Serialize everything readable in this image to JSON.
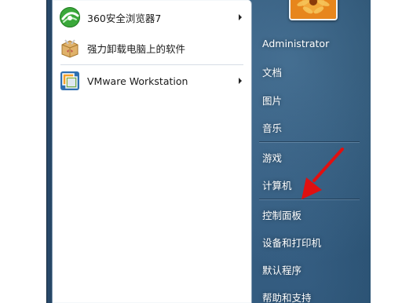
{
  "start_menu": {
    "programs": [
      {
        "label": "360安全浏览器7",
        "icon": "browser-360-icon",
        "has_submenu": true
      },
      {
        "label": "强力卸载电脑上的软件",
        "icon": "uninstall-box-icon",
        "has_submenu": false
      },
      {
        "label": "VMware Workstation",
        "icon": "vmware-icon",
        "has_submenu": true
      }
    ],
    "right_items": {
      "user": "Administrator",
      "documents": "文档",
      "pictures": "图片",
      "music": "音乐",
      "games": "游戏",
      "computer": "计算机",
      "control_panel": "控制面板",
      "devices_printers": "设备和打印机",
      "default_programs": "默认程序",
      "help_support": "帮助和支持"
    },
    "user_picture": "flower-avatar",
    "annotation": {
      "type": "red-arrow",
      "target": "控制面板",
      "color": "#e01010"
    }
  },
  "colors": {
    "menu_bg": "#2f5577",
    "left_pane_bg": "#ffffff",
    "right_text": "#ffffff",
    "arrow": "#e01010"
  }
}
